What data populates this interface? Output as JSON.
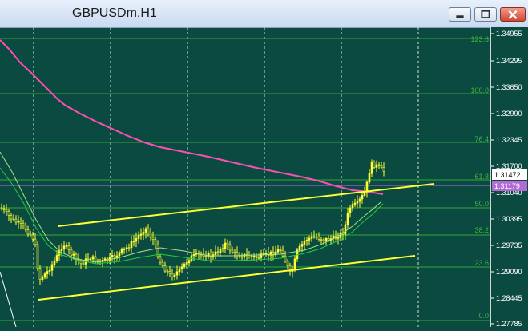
{
  "window": {
    "title": "GBPUSDm,H1"
  },
  "colors": {
    "background": "#0b4a41",
    "candles": "#ffff33",
    "fib_lines": "#35a835",
    "ma_long": "#ff4fb0",
    "ma_green": "#1fcf3a",
    "ma_pale": "#a8e28a",
    "channel": "#ffff33",
    "price_line": "#b06bff",
    "bid_label_bg": "#b36bd6",
    "ask_label_bg": "#ffffff"
  },
  "price_axis": {
    "ticks": [
      "1.34955",
      "1.34295",
      "1.33650",
      "1.32990",
      "1.32345",
      "1.31700",
      "1.31040",
      "1.30395",
      "1.29735",
      "1.29090",
      "1.28445",
      "1.27785"
    ],
    "ask_label": "1.31472",
    "bid_label": "1.31179"
  },
  "fibonacci": {
    "levels": [
      "123.6",
      "100.0",
      "76.4",
      "61.8",
      "50.0",
      "38.2",
      "23.6",
      "0.0"
    ]
  }
}
